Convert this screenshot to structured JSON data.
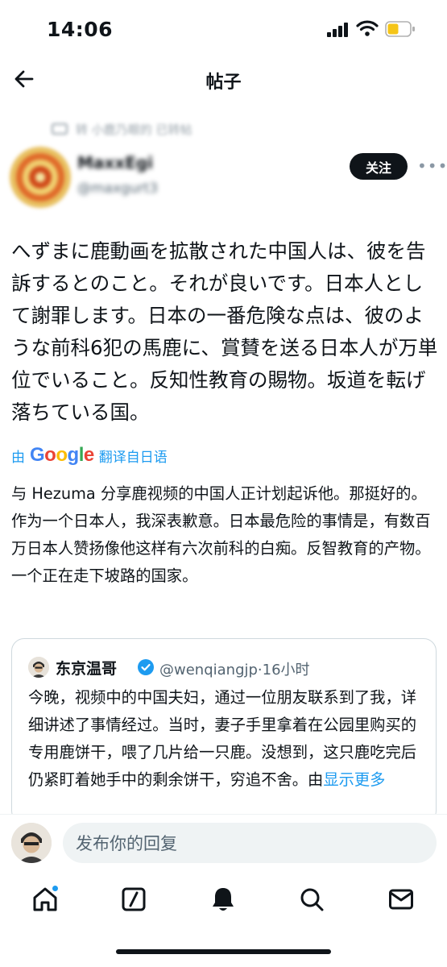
{
  "status_bar": {
    "time": "14:06"
  },
  "header": {
    "title": "帖子"
  },
  "repost": {
    "text": "转 小鹿乃眼的 已转帖"
  },
  "author": {
    "name": "MaxxEgi",
    "handle": "@maxgurt3"
  },
  "follow_label": "关注",
  "post": {
    "text": "へずまに鹿動画を拡散された中国人は、彼を告訴するとのこと。それが良いです。日本人として謝罪します。日本の一番危険な点は、彼のような前科6犯の馬鹿に、賞賛を送る日本人が万単位でいること。反知性教育の賜物。坂道を転げ落ちている国。",
    "translate_prefix": "由",
    "translate_brand": "Google",
    "translate_suffix": "翻译自日语",
    "translated_text": "与 Hezuma 分享鹿视频的中国人正计划起诉他。那挺好的。作为一个日本人，我深表歉意。日本最危险的事情是，有数百万日本人赞扬像他这样有六次前科的白痴。反智教育的产物。一个正在走下坡路的国家。"
  },
  "quote": {
    "name": "东京温哥",
    "handle": "@wenqiangjp",
    "time": "·16小时",
    "text": "今晚，视频中的中国夫妇，通过一位朋友联系到了我，详细讲述了事情经过。当时，妻子手里拿着在公园里购买的专用鹿饼干，喂了几片给一只鹿。没想到，这只鹿吃完后仍紧盯着她手中的剩余饼干，穷追不舍。由",
    "show_more": "显示更多"
  },
  "reply": {
    "placeholder": "发布你的回复"
  },
  "colors": {
    "accent": "#1d9bf0",
    "text": "#0f1419",
    "muted": "#536471"
  }
}
